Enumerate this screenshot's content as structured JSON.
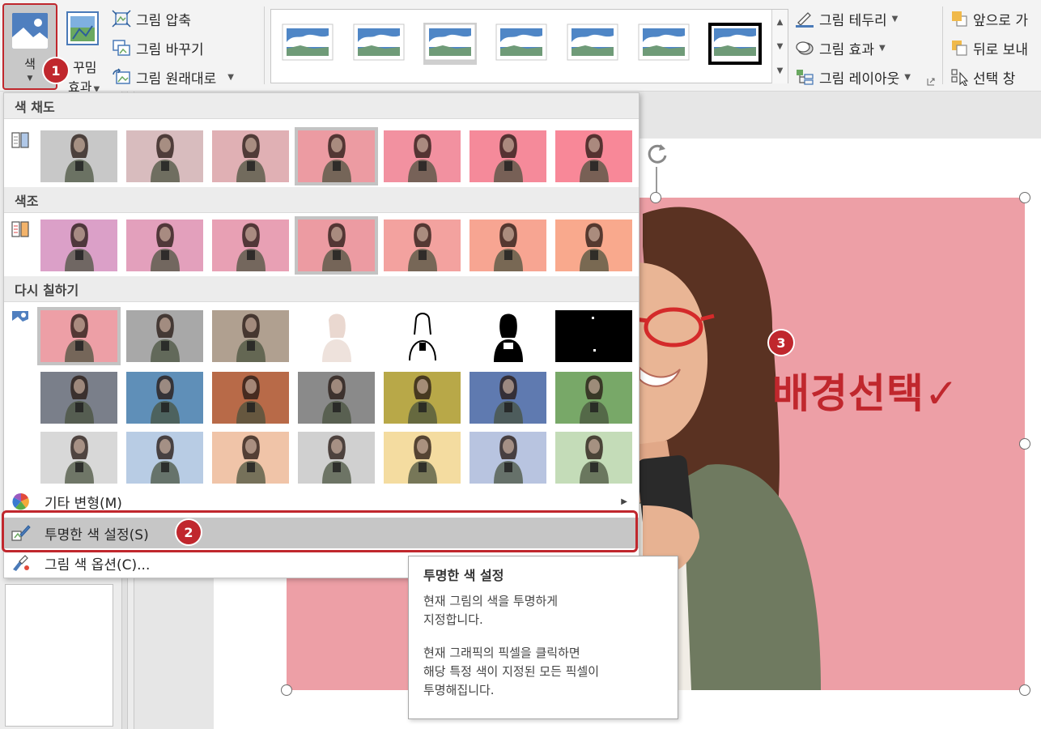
{
  "ribbon": {
    "color_button": {
      "label": "색"
    },
    "artistic_effects": {
      "label_line1": "꾸밈",
      "label_line2": "효과"
    },
    "adjust": {
      "compress": "그림 압축",
      "change": "그림 바꾸기",
      "reset": "그림 원래대로"
    },
    "picture_styles_count": 7,
    "arrange_left": {
      "border": "그림 테두리",
      "effects": "그림 효과",
      "layout": "그림 레이아웃"
    },
    "arrange_right": {
      "bring_forward": "앞으로 가",
      "send_backward": "뒤로 보내",
      "selection_pane": "선택 창"
    }
  },
  "dropdown": {
    "saturation": {
      "title": "색 채도",
      "swatch_colors": [
        "#c8c8c8",
        "#d8bcbe",
        "#e0b0b4",
        "#ec9ba2",
        "#f291a0",
        "#f58a9a",
        "#f88898"
      ],
      "selected_index": 3
    },
    "tone": {
      "title": "색조",
      "swatch_colors": [
        "#dba0c8",
        "#e3a0bc",
        "#e8a0b4",
        "#ec9ba2",
        "#f3a29f",
        "#f7a592",
        "#f9a98d"
      ],
      "selected_index": 3
    },
    "recolor": {
      "title": "다시 칠하기",
      "rows": [
        [
          "#ed9fa6",
          "#a8a8a8",
          "#b0a090",
          "#ffffff",
          "#ffffff",
          "#ffffff",
          "#000000"
        ],
        [
          "#7a7f8a",
          "#5f8fb8",
          "#b86a48",
          "#8a8a8a",
          "#b8a848",
          "#5f7ab0",
          "#78a868"
        ],
        [
          "#d8d8d8",
          "#b8cce4",
          "#f0c4a8",
          "#d0d0d0",
          "#f4dca0",
          "#b8c4e0",
          "#c4dcb8"
        ]
      ],
      "selected": "0-0"
    },
    "more_variations": "기타 변형(M)",
    "set_transparent": "투명한 색 설정(S)",
    "color_options": "그림 색 옵션(C)..."
  },
  "tooltip": {
    "title": "투명한 색 설정",
    "line1": "현재 그림의 색을 투명하게",
    "line2": "지정합니다.",
    "line3": "현재 그래픽의 픽셀을 클릭하면",
    "line4": "해당 특정 색이 지정된 모든 픽셀이",
    "line5": "투명해집니다."
  },
  "steps": {
    "one": "1",
    "two": "2",
    "three": "3"
  },
  "callout": "배경선택✓",
  "colors": {
    "accent": "#c0272d",
    "picture_bg": "#ed9fa6"
  }
}
